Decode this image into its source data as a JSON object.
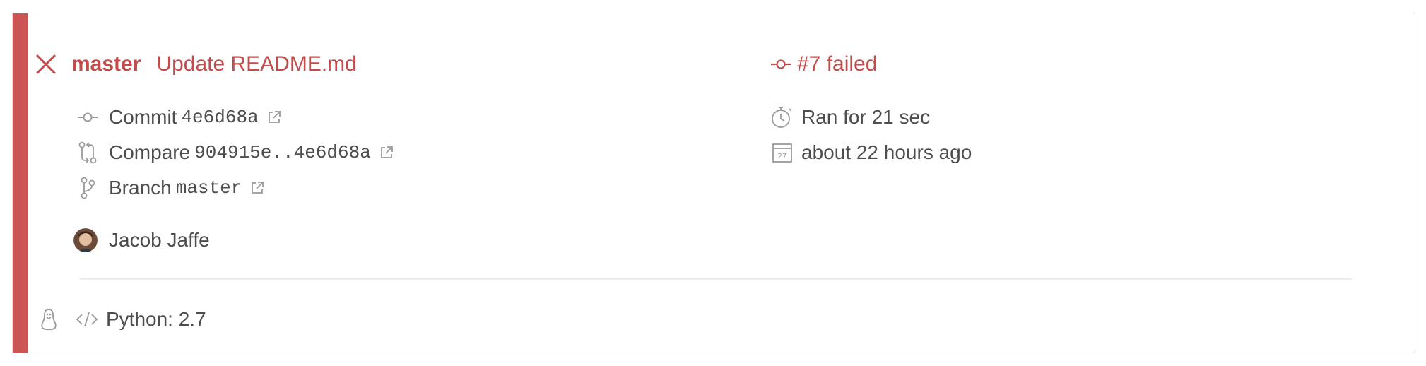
{
  "build": {
    "status": "failed",
    "branch": "master",
    "commit_message": "Update README.md",
    "build_label": "#7 failed"
  },
  "details": {
    "commit_label": "Commit",
    "commit_sha": "4e6d68a",
    "compare_label": "Compare",
    "compare_range": "904915e..4e6d68a",
    "branch_label": "Branch",
    "branch_name": "master",
    "author": "Jacob Jaffe",
    "duration": "Ran for 21 sec",
    "finished": "about 22 hours ago",
    "calendar_day": "27"
  },
  "job": {
    "language": "Python: 2.7"
  },
  "colors": {
    "failed": "#c54b4b",
    "status_bar": "#cb5454",
    "text": "#4d4d4d",
    "icon": "#9a9a9a"
  },
  "icons": [
    "close-icon",
    "commit-icon",
    "compare-icon",
    "branch-icon",
    "external-link-icon",
    "stopwatch-icon",
    "calendar-icon",
    "linux-icon",
    "code-icon"
  ]
}
